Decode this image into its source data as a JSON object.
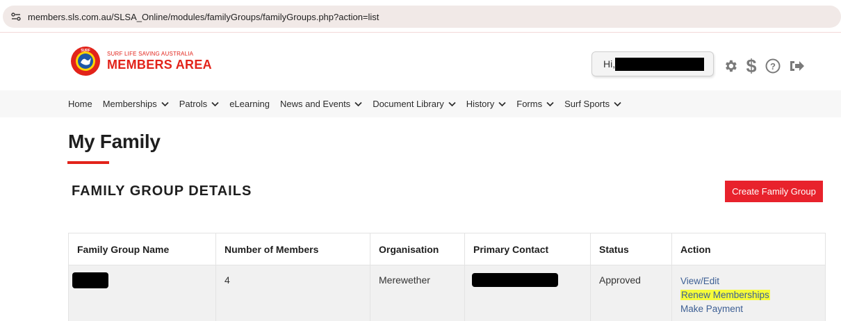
{
  "browser": {
    "url": "members.sls.com.au/SLSA_Online/modules/familyGroups/familyGroups.php?action=list",
    "site_icon": "tune-icon"
  },
  "header": {
    "logo_small": "SURF LIFE SAVING AUSTRALIA",
    "logo_big": "MEMBERS AREA",
    "logo_badge_text": "SURF LIFE SAVING",
    "greeting": "Hi,",
    "icons": [
      "gear-icon",
      "dollar-icon",
      "help-icon",
      "logout-icon"
    ]
  },
  "nav": {
    "items": [
      {
        "label": "Home",
        "dropdown": false
      },
      {
        "label": "Memberships",
        "dropdown": true
      },
      {
        "label": "Patrols",
        "dropdown": true
      },
      {
        "label": "eLearning",
        "dropdown": false
      },
      {
        "label": "News and Events",
        "dropdown": true
      },
      {
        "label": "Document Library",
        "dropdown": true
      },
      {
        "label": "History",
        "dropdown": true
      },
      {
        "label": "Forms",
        "dropdown": true
      },
      {
        "label": "Surf Sports",
        "dropdown": true
      }
    ]
  },
  "main": {
    "title": "My Family",
    "section_title": "FAMILY GROUP DETAILS",
    "create_button": "Create Family Group",
    "table": {
      "headers": [
        "Family Group Name",
        "Number of Members",
        "Organisation",
        "Primary Contact",
        "Status",
        "Action"
      ],
      "rows": [
        {
          "name": "",
          "members": "4",
          "organisation": "Merewether",
          "primary_contact": "",
          "status": "Approved",
          "actions": [
            "View/Edit",
            "Renew Memberships",
            "Make Payment"
          ]
        }
      ]
    }
  },
  "colors": {
    "brand_red": "#e2231a",
    "button_red": "#e8222c",
    "link_blue": "#3d5f94",
    "highlight": "#f6fb3a"
  }
}
